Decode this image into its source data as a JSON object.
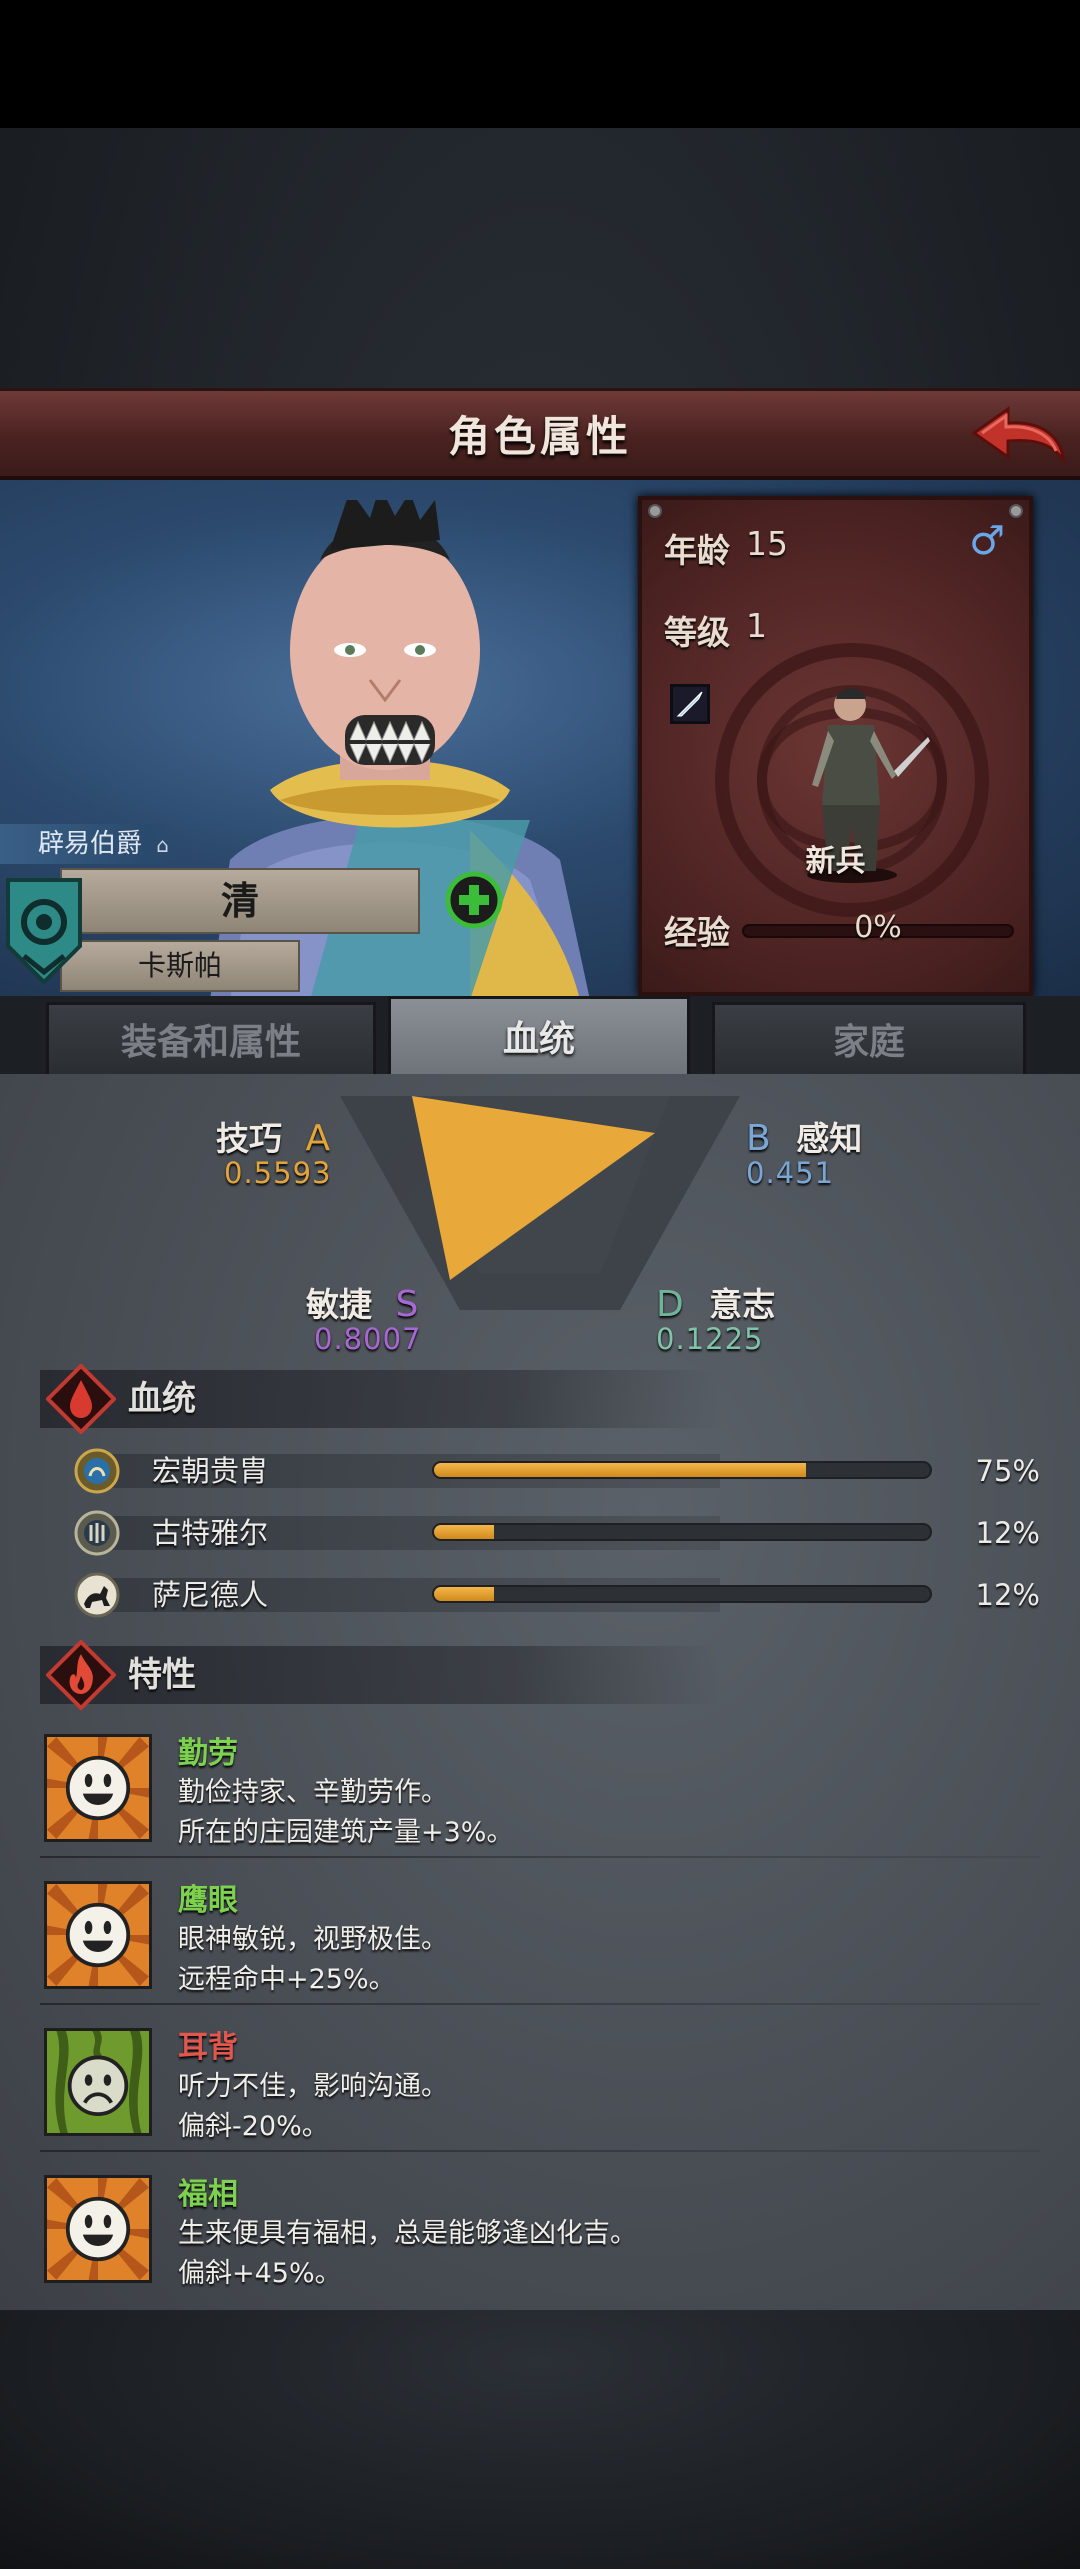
{
  "header": {
    "title": "角色属性"
  },
  "character": {
    "title_tag": "辟易伯爵",
    "name": "清",
    "family": "卡斯帕"
  },
  "stats_card": {
    "age_label": "年龄",
    "age_value": "15",
    "gender_symbol": "♂",
    "level_label": "等级",
    "level_value": "1",
    "rank": "新兵",
    "exp_label": "经验",
    "exp_value": "0%",
    "exp_fraction": 0
  },
  "tabs": [
    {
      "label": "装备和属性",
      "active": false
    },
    {
      "label": "血统",
      "active": true
    },
    {
      "label": "家庭",
      "active": false
    }
  ],
  "attributes": {
    "skill": {
      "label": "技巧",
      "grade": "A",
      "value": "0.5593"
    },
    "perception": {
      "label": "感知",
      "grade": "B",
      "value": "0.451"
    },
    "agility": {
      "label": "敏捷",
      "grade": "S",
      "value": "0.8007"
    },
    "will": {
      "label": "意志",
      "grade": "D",
      "value": "0.1225"
    }
  },
  "bloodline_section": {
    "title": "血统",
    "items": [
      {
        "name": "宏朝贵胄",
        "percent_text": "75%",
        "fraction": 0.75
      },
      {
        "name": "古特雅尔",
        "percent_text": "12%",
        "fraction": 0.12
      },
      {
        "name": "萨尼德人",
        "percent_text": "12%",
        "fraction": 0.12
      }
    ]
  },
  "traits_section": {
    "title": "特性",
    "items": [
      {
        "name": "勤劳",
        "line1": "勤俭持家、辛勤劳作。",
        "line2": "所在的庄园建筑产量+3%。",
        "positive": true
      },
      {
        "name": "鹰眼",
        "line1": "眼神敏锐，视野极佳。",
        "line2": "远程命中+25%。",
        "positive": true
      },
      {
        "name": "耳背",
        "line1": "听力不佳，影响沟通。",
        "line2": "偏斜-20%。",
        "positive": false
      },
      {
        "name": "福相",
        "line1": "生来便具有福相，总是能够逢凶化吉。",
        "line2": "偏斜+45%。",
        "positive": true
      }
    ]
  },
  "colors": {
    "grade_A": "#e3a53a",
    "grade_B": "#7aa7d6",
    "grade_S": "#a967d4",
    "grade_D": "#6fb49a",
    "val_skill": "#e3a53a",
    "val_perception": "#7aa7d6",
    "val_agility": "#a967d4",
    "val_will": "#7fc4a8",
    "trait_positive": "#7ed14f",
    "trait_negative": "#e0574e",
    "radar_fill": "#e8a83a"
  }
}
